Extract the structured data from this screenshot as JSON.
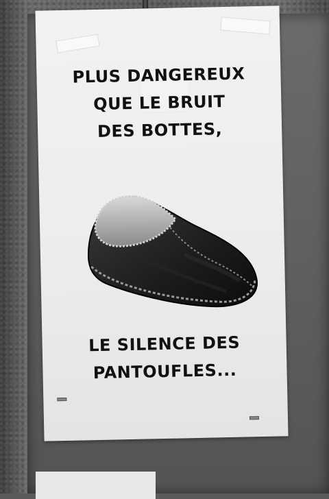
{
  "poster": {
    "line1": "PLUS DANGEREUX",
    "line2": "QUE LE BRUIT",
    "line3": "DES BOTTES,",
    "line4": "LE SILENCE DES",
    "line5": "PANTOUFLES..."
  },
  "colors": {
    "ink": "#111111",
    "paper": "#f0f0f0",
    "wall": "#5a5a5a"
  },
  "icons": {
    "illustration": "slipper-icon"
  }
}
